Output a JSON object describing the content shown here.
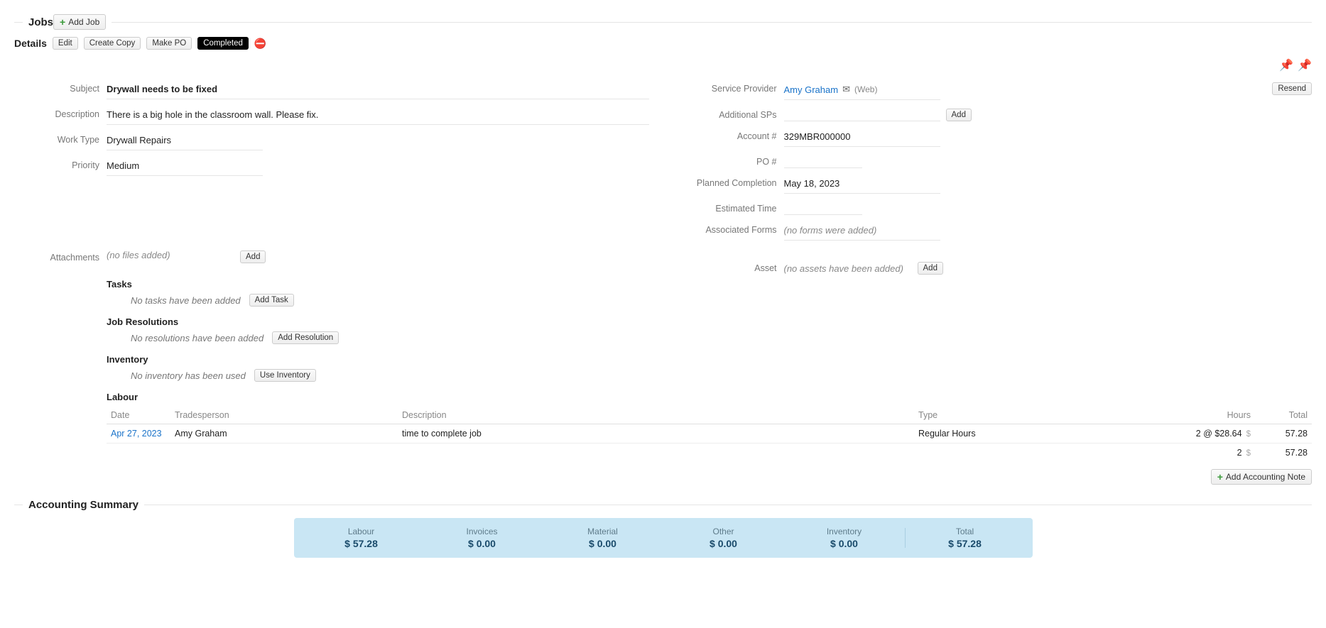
{
  "jobs": {
    "title": "Jobs",
    "add_job_label": "Add Job"
  },
  "details": {
    "label": "Details",
    "buttons": {
      "edit": "Edit",
      "create_copy": "Create Copy",
      "make_po": "Make PO"
    },
    "status": "Completed"
  },
  "left": {
    "subject": {
      "label": "Subject",
      "value": "Drywall needs to be fixed"
    },
    "description": {
      "label": "Description",
      "value": "There is a big hole in the classroom wall. Please fix."
    },
    "work_type": {
      "label": "Work Type",
      "value": "Drywall Repairs"
    },
    "priority": {
      "label": "Priority",
      "value": "Medium"
    },
    "attachments": {
      "label": "Attachments",
      "empty": "(no files added)",
      "add": "Add"
    },
    "tasks": {
      "title": "Tasks",
      "empty": "No tasks have been added",
      "add": "Add Task"
    },
    "resolutions": {
      "title": "Job Resolutions",
      "empty": "No resolutions have been added",
      "add": "Add Resolution"
    },
    "inventory": {
      "title": "Inventory",
      "empty": "No inventory has been used",
      "add": "Use Inventory"
    },
    "labour": {
      "title": "Labour",
      "headers": {
        "date": "Date",
        "tradesperson": "Tradesperson",
        "description": "Description",
        "type": "Type",
        "hours": "Hours",
        "total": "Total"
      },
      "rows": [
        {
          "date": "Apr 27, 2023",
          "tradesperson": "Amy Graham",
          "description": "time to complete job",
          "type": "Regular Hours",
          "hours": "2 @ $28.64",
          "total": "57.28"
        }
      ],
      "totals": {
        "hours": "2",
        "total": "57.28"
      }
    },
    "add_accounting_note": "Add Accounting Note"
  },
  "right": {
    "service_provider": {
      "label": "Service Provider",
      "name": "Amy Graham",
      "via": "(Web)",
      "resend": "Resend"
    },
    "additional_sps": {
      "label": "Additional SPs",
      "add": "Add"
    },
    "account": {
      "label": "Account #",
      "value": "329MBR000000"
    },
    "po": {
      "label": "PO #",
      "value": ""
    },
    "planned_completion": {
      "label": "Planned Completion",
      "value": "May 18, 2023"
    },
    "estimated_time": {
      "label": "Estimated Time",
      "value": ""
    },
    "associated_forms": {
      "label": "Associated Forms",
      "empty": "(no forms were added)"
    },
    "asset": {
      "label": "Asset",
      "empty": "(no assets have been added)",
      "add": "Add"
    }
  },
  "accounting": {
    "title": "Accounting Summary",
    "items": {
      "labour": {
        "label": "Labour",
        "value": "$ 57.28"
      },
      "invoices": {
        "label": "Invoices",
        "value": "$ 0.00"
      },
      "material": {
        "label": "Material",
        "value": "$ 0.00"
      },
      "other": {
        "label": "Other",
        "value": "$ 0.00"
      },
      "inventory": {
        "label": "Inventory",
        "value": "$ 0.00"
      },
      "total": {
        "label": "Total",
        "value": "$ 57.28"
      }
    }
  }
}
